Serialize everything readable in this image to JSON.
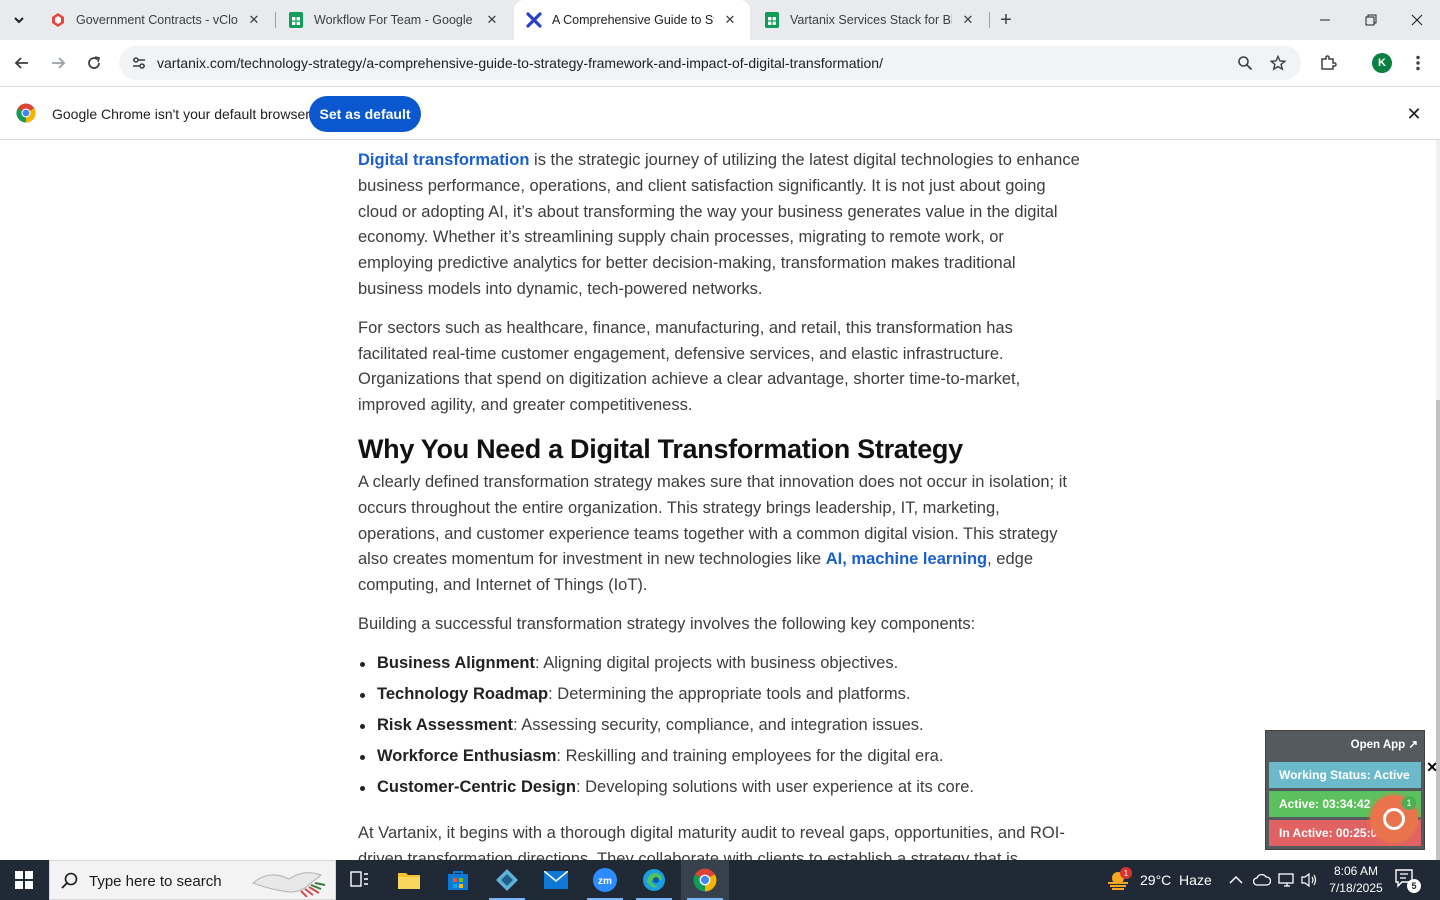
{
  "browser": {
    "tabs": [
      {
        "title": "Government Contracts - vCloud",
        "icon": "vcloud-favicon",
        "active": false
      },
      {
        "title": "Workflow For Team - Google Sheets",
        "icon": "sheets-favicon",
        "active": false
      },
      {
        "title": "A Comprehensive Guide to Strategy",
        "icon": "vartanix-favicon",
        "active": true
      },
      {
        "title": "Vartanix Services Stack for Blog",
        "icon": "sheets-favicon",
        "active": false
      }
    ],
    "url": "vartanix.com/technology-strategy/a-comprehensive-guide-to-strategy-framework-and-impact-of-digital-transformation/",
    "profile_initial": "K",
    "infobar": {
      "message": "Google Chrome isn't your default browser",
      "button": "Set as default"
    }
  },
  "article": {
    "p1_link": "Digital transformation",
    "p1_text": " is the strategic journey of utilizing the latest digital technologies to enhance business performance, operations, and client satisfaction significantly. It is not just about going cloud or adopting AI, it’s about transforming the way your business generates value in the digital economy. Whether it’s streamlining supply chain processes, migrating to remote work, or employing predictive analytics for better decision-making, transformation makes traditional business models into dynamic, tech-powered networks.",
    "p2": "For sectors such as healthcare, finance, manufacturing, and retail, this transformation has facilitated real-time customer engagement, defensive services, and elastic infrastructure. Organizations that spend on digitization achieve a clear advantage, shorter time-to-market, improved agility, and greater competitiveness.",
    "h2": "Why You Need a Digital Transformation Strategy",
    "p3_a": "A clearly defined transformation strategy makes sure that innovation does not occur in isolation; it occurs throughout the entire organization. This strategy brings leadership, IT, marketing, operations, and customer experience teams together with a common digital vision. This strategy also creates momentum for investment in new technologies like ",
    "p3_link1": "AI",
    "p3_comma": ", ",
    "p3_link2": "machine learning",
    "p3_b": ", edge computing, and Internet of Things (IoT).",
    "p4": "Building a successful transformation strategy involves the following key components:",
    "bullets": [
      {
        "term": "Business Alignment",
        "desc": ": Aligning digital projects with business objectives."
      },
      {
        "term": "Technology Roadmap",
        "desc": ": Determining the appropriate tools and platforms."
      },
      {
        "term": "Risk Assessment",
        "desc": ": Assessing security, compliance, and integration issues."
      },
      {
        "term": "Workforce Enthusiasm",
        "desc": ": Reskilling and training employees for the digital era."
      },
      {
        "term": "Customer-Centric Design",
        "desc": ": Developing solutions with user experience at its core."
      }
    ],
    "p5": "At Vartanix, it begins with a thorough digital maturity audit to reveal gaps, opportunities, and ROI-driven transformation directions. They collaborate with clients to establish a strategy that is"
  },
  "tracker_widget": {
    "open_app": "Open App ↗",
    "status": "Working Status: Active",
    "active": "Active: 03:34:42",
    "inactive": "In Active: 00:25:01",
    "badge": "1"
  },
  "taskbar": {
    "search_placeholder": "Type here to search",
    "weather_badge": "1",
    "weather": "29°C  Haze",
    "time": "8:06 AM",
    "date": "7/18/2025",
    "notification_count": "5"
  },
  "colors": {
    "accent_blue": "#0b57d0",
    "link_blue": "#1a5fd0",
    "taskbar": "#202a36",
    "status_teal": "#6bb9c9",
    "active_green": "#5cc05c",
    "inactive_red": "#e06262"
  }
}
